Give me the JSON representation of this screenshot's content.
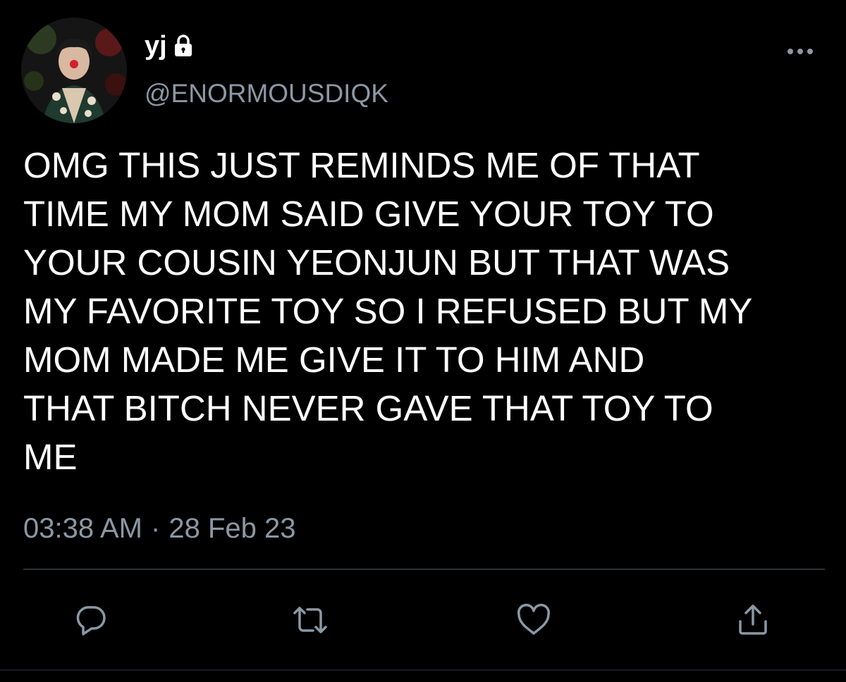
{
  "author": {
    "display_name": "yj",
    "handle": "@ENORMOUSDIQK",
    "avatar_icon": "profile-photo",
    "protected_icon": "lock-icon"
  },
  "tweet": {
    "text": "OMG THIS JUST REMINDS ME OF THAT\nTIME MY MOM SAID GIVE YOUR TOY TO\nYOUR COUSIN YEONJUN BUT THAT WAS\nMY FAVORITE TOY SO I REFUSED BUT MY\nMOM MADE ME GIVE IT TO HIM AND\nTHAT BITCH NEVER GAVE THAT TOY TO\nME",
    "time": "03:38 AM",
    "separator": "·",
    "date": "28 Feb 23"
  },
  "actions": [
    {
      "name": "reply",
      "icon": "reply-icon"
    },
    {
      "name": "retweet",
      "icon": "retweet-icon"
    },
    {
      "name": "like",
      "icon": "heart-icon"
    },
    {
      "name": "share",
      "icon": "share-icon"
    }
  ],
  "colors": {
    "background": "#000000",
    "text": "#ffffff",
    "secondary_text": "#8b98a5",
    "divider": "#2f3336"
  }
}
